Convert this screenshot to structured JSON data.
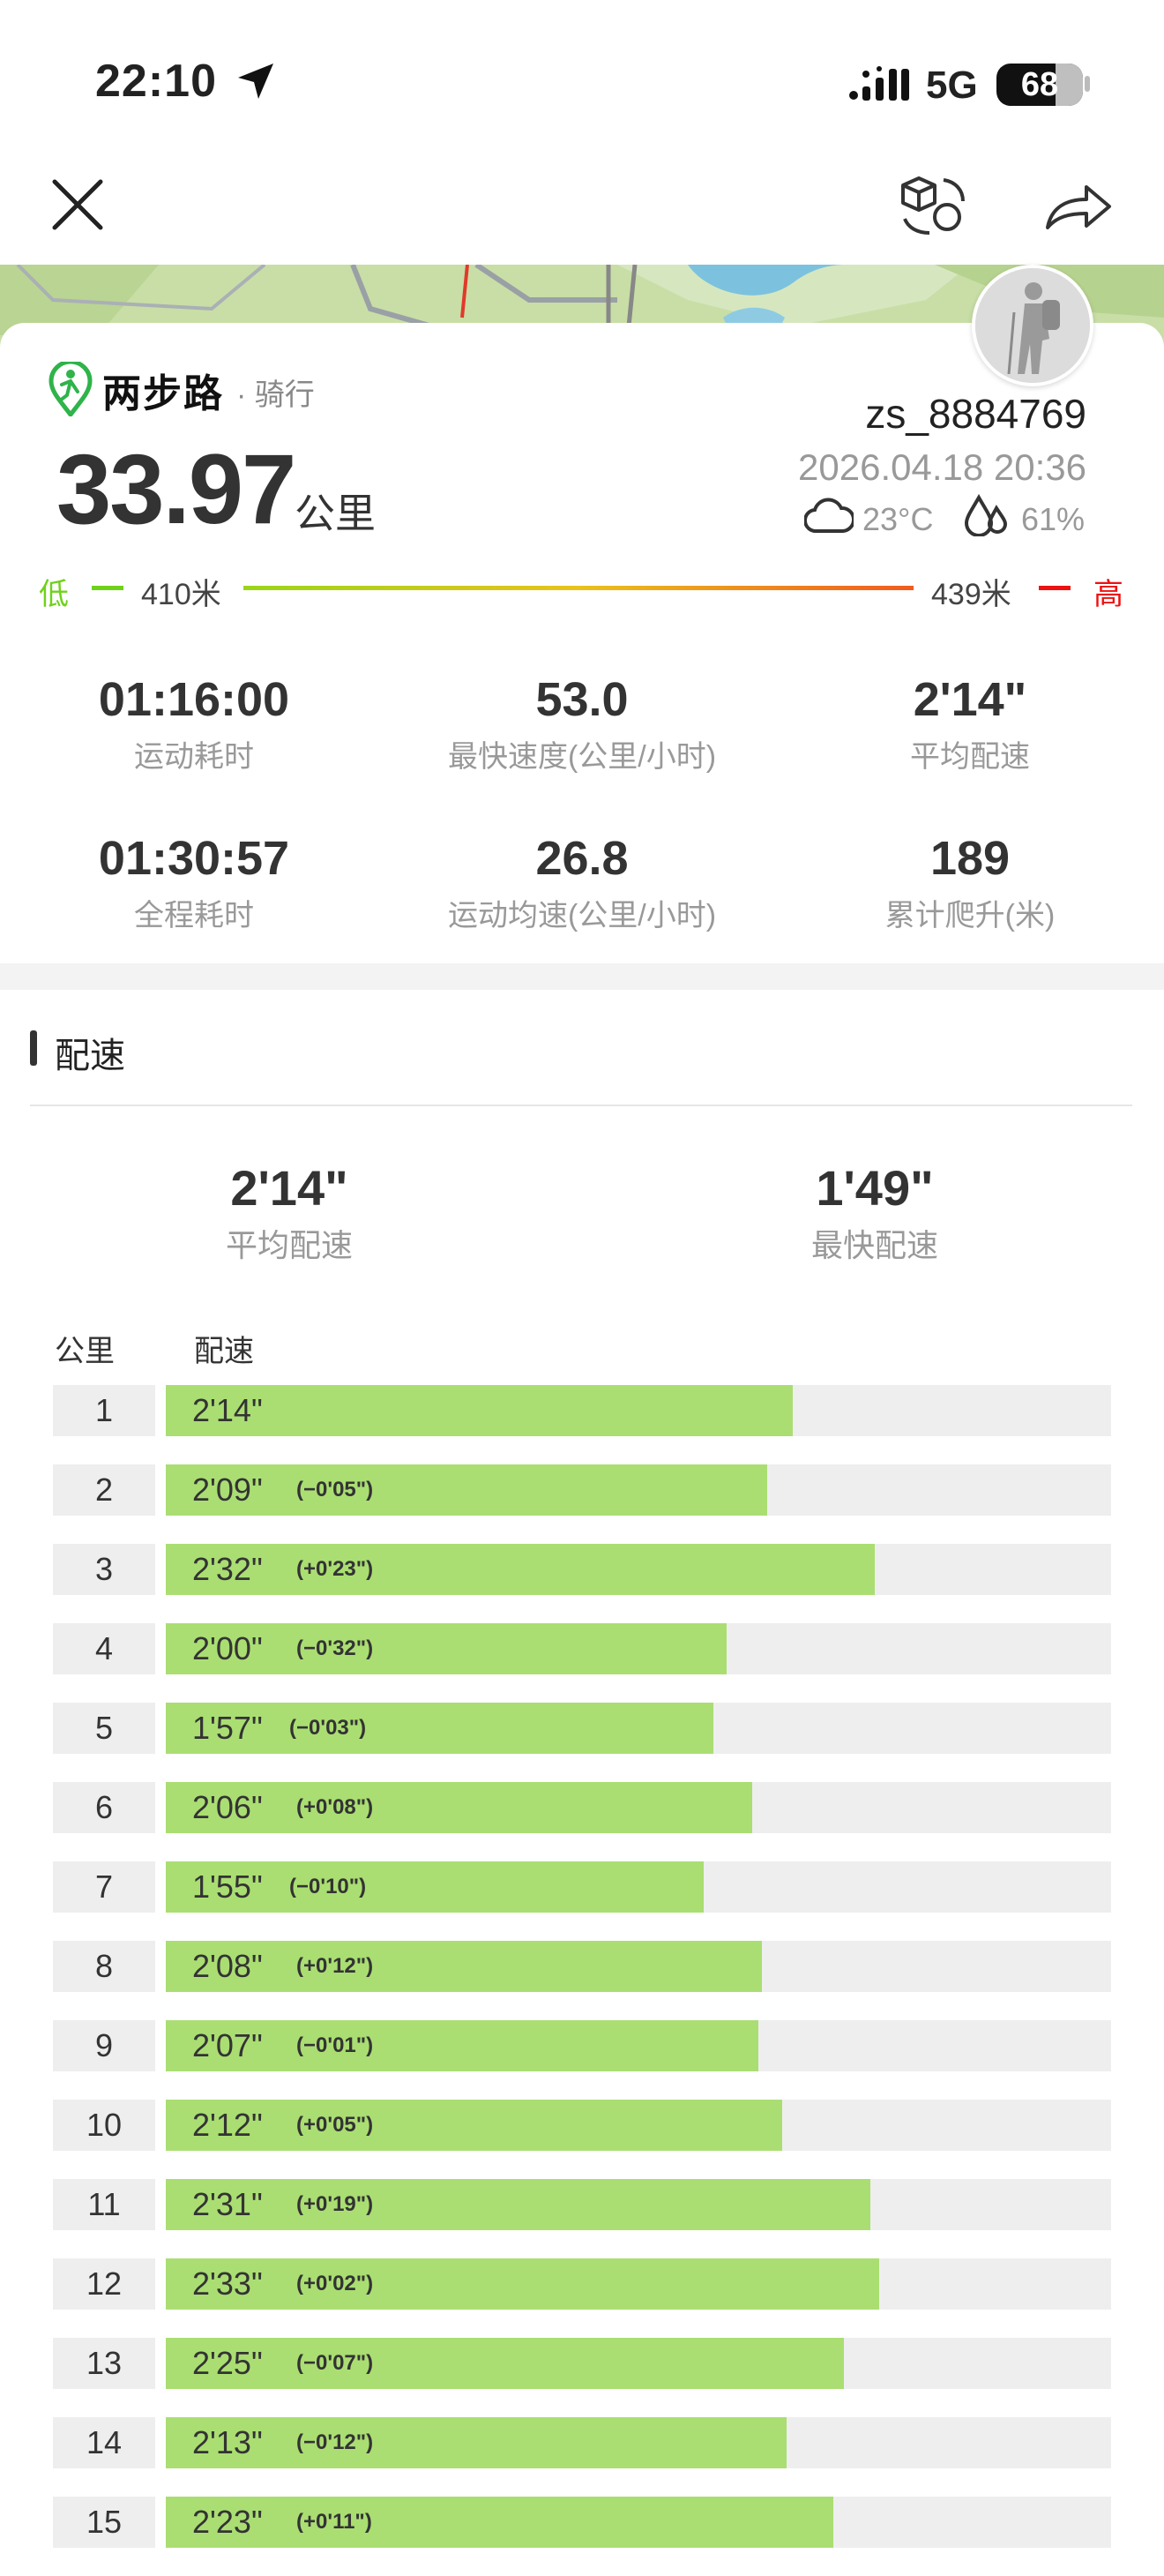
{
  "status_bar": {
    "time": "22:10",
    "network": "5G",
    "battery": "68",
    "battery_level": 0.68
  },
  "card": {
    "brand": "两步路",
    "sport": "· 骑行",
    "distance": "33.97",
    "distance_unit": "公里",
    "username": "zs_8884769",
    "datetime": "2026.04.18 20:36",
    "temperature": "23°C",
    "humidity": "61%"
  },
  "elevation": {
    "low_label": "低",
    "min": "410米",
    "max": "439米",
    "high_label": "高"
  },
  "stats": [
    {
      "value": "01:16:00",
      "label": "运动耗时"
    },
    {
      "value": "53.0",
      "label": "最快速度(公里/小时)"
    },
    {
      "value": "2'14\"",
      "label": "平均配速"
    },
    {
      "value": "01:30:57",
      "label": "全程耗时"
    },
    {
      "value": "26.8",
      "label": "运动均速(公里/小时)"
    },
    {
      "value": "189",
      "label": "累计爬升(米)"
    }
  ],
  "pace_section": {
    "title": "配速",
    "avg": {
      "value": "2'14\"",
      "label": "平均配速"
    },
    "fastest": {
      "value": "1'49\"",
      "label": "最快配速"
    },
    "col_km": "公里",
    "col_pace": "配速",
    "rows": [
      {
        "km": "1",
        "pace": "2'14\"",
        "diff": "",
        "ratio": 0.663
      },
      {
        "km": "2",
        "pace": "2'09\"",
        "diff": "(−0'05\")",
        "ratio": 0.636
      },
      {
        "km": "3",
        "pace": "2'32\"",
        "diff": "(+0'23\")",
        "ratio": 0.75
      },
      {
        "km": "4",
        "pace": "2'00\"",
        "diff": "(−0'32\")",
        "ratio": 0.593
      },
      {
        "km": "5",
        "pace": "1'57\"",
        "diff": "(−0'03\")",
        "ratio": 0.579
      },
      {
        "km": "6",
        "pace": "2'06\"",
        "diff": "(+0'08\")",
        "ratio": 0.62
      },
      {
        "km": "7",
        "pace": "1'55\"",
        "diff": "(−0'10\")",
        "ratio": 0.569
      },
      {
        "km": "8",
        "pace": "2'08\"",
        "diff": "(+0'12\")",
        "ratio": 0.631
      },
      {
        "km": "9",
        "pace": "2'07\"",
        "diff": "(−0'01\")",
        "ratio": 0.627
      },
      {
        "km": "10",
        "pace": "2'12\"",
        "diff": "(+0'05\")",
        "ratio": 0.652
      },
      {
        "km": "11",
        "pace": "2'31\"",
        "diff": "(+0'19\")",
        "ratio": 0.745
      },
      {
        "km": "12",
        "pace": "2'33\"",
        "diff": "(+0'02\")",
        "ratio": 0.755
      },
      {
        "km": "13",
        "pace": "2'25\"",
        "diff": "(−0'07\")",
        "ratio": 0.717
      },
      {
        "km": "14",
        "pace": "2'13\"",
        "diff": "(−0'12\")",
        "ratio": 0.657
      },
      {
        "km": "15",
        "pace": "2'23\"",
        "diff": "(+0'11\")",
        "ratio": 0.706
      }
    ]
  },
  "colors": {
    "bar_fill": "#aade72",
    "low": "#6fd11a",
    "high": "#e11111"
  }
}
